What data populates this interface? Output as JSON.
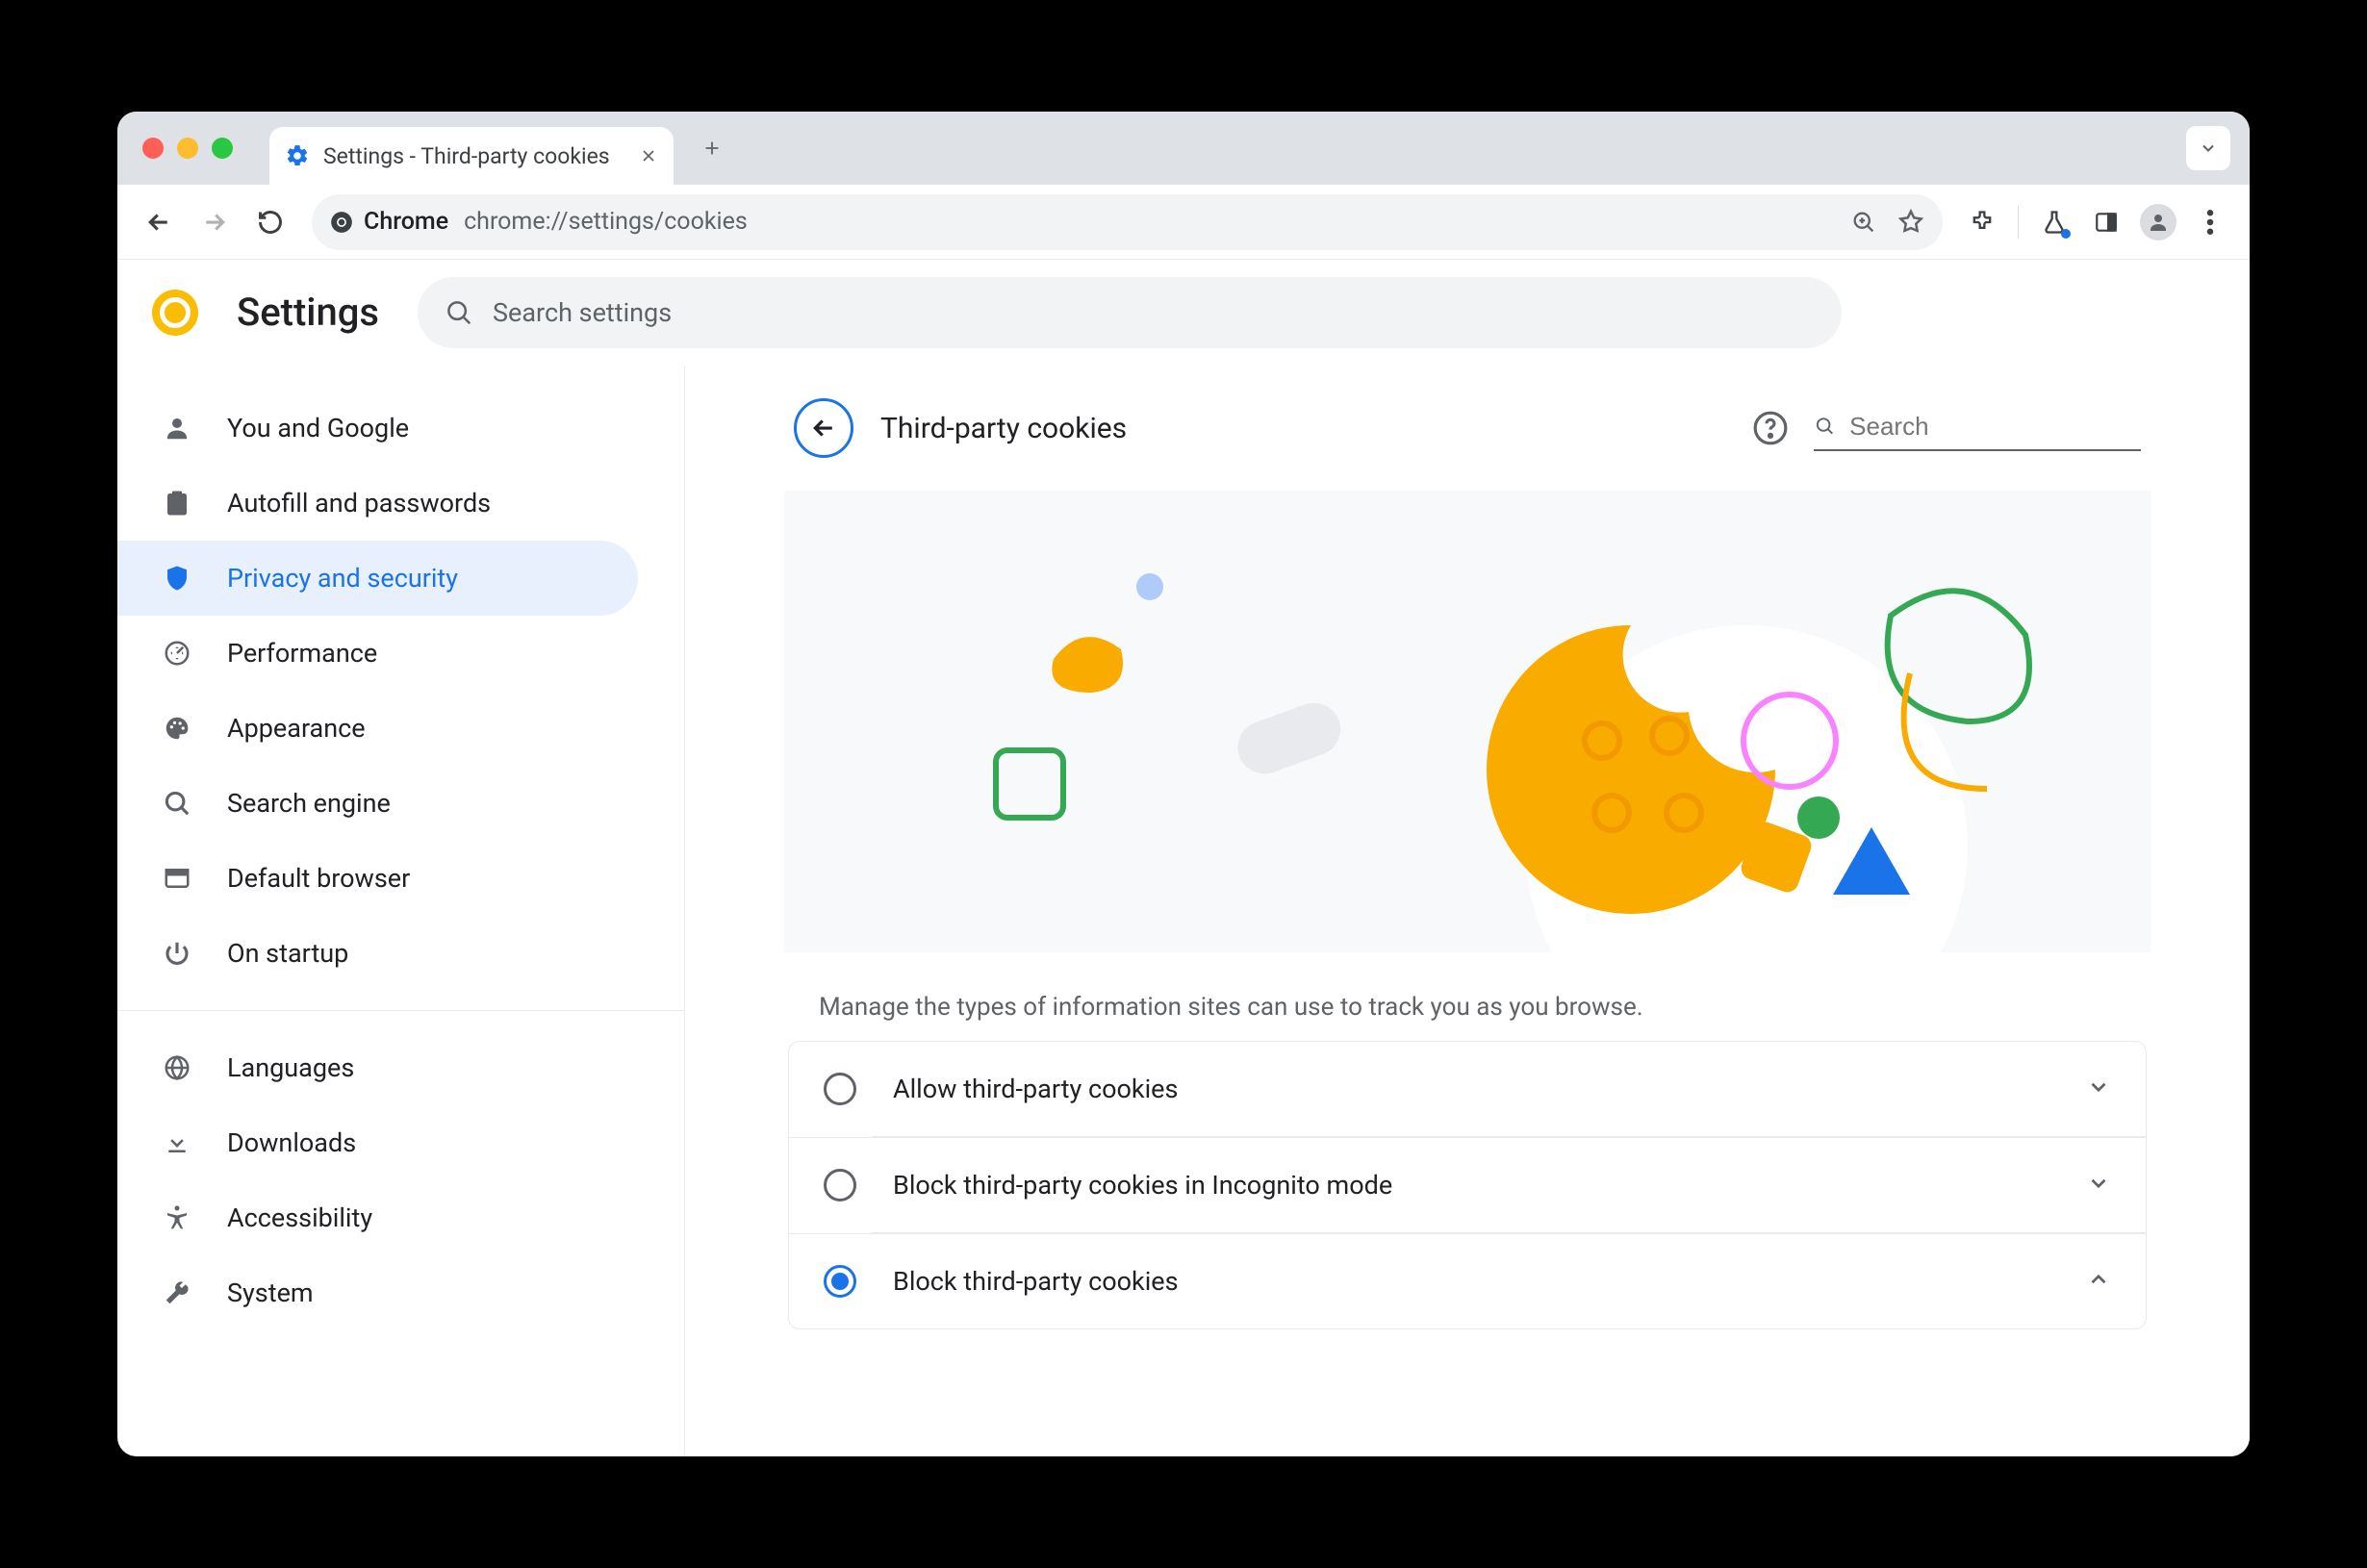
{
  "browser": {
    "tab_title": "Settings - Third-party cookies",
    "omnibox_chip": "Chrome",
    "url": "chrome://settings/cookies"
  },
  "header": {
    "app_name": "Settings",
    "search_placeholder": "Search settings"
  },
  "sidebar": {
    "groups": [
      [
        {
          "icon": "person",
          "label": "You and Google"
        },
        {
          "icon": "clipboard",
          "label": "Autofill and passwords"
        },
        {
          "icon": "shield",
          "label": "Privacy and security",
          "active": true
        },
        {
          "icon": "speed",
          "label": "Performance"
        },
        {
          "icon": "palette",
          "label": "Appearance"
        },
        {
          "icon": "search",
          "label": "Search engine"
        },
        {
          "icon": "browser",
          "label": "Default browser"
        },
        {
          "icon": "power",
          "label": "On startup"
        }
      ],
      [
        {
          "icon": "globe",
          "label": "Languages"
        },
        {
          "icon": "download",
          "label": "Downloads"
        },
        {
          "icon": "accessibility",
          "label": "Accessibility"
        },
        {
          "icon": "wrench",
          "label": "System"
        }
      ]
    ]
  },
  "page": {
    "title": "Third-party cookies",
    "search_placeholder": "Search",
    "description": "Manage the types of information sites can use to track you as you browse.",
    "options": [
      {
        "label": "Allow third-party cookies",
        "selected": false,
        "expanded": false
      },
      {
        "label": "Block third-party cookies in Incognito mode",
        "selected": false,
        "expanded": false
      },
      {
        "label": "Block third-party cookies",
        "selected": true,
        "expanded": true
      }
    ]
  }
}
